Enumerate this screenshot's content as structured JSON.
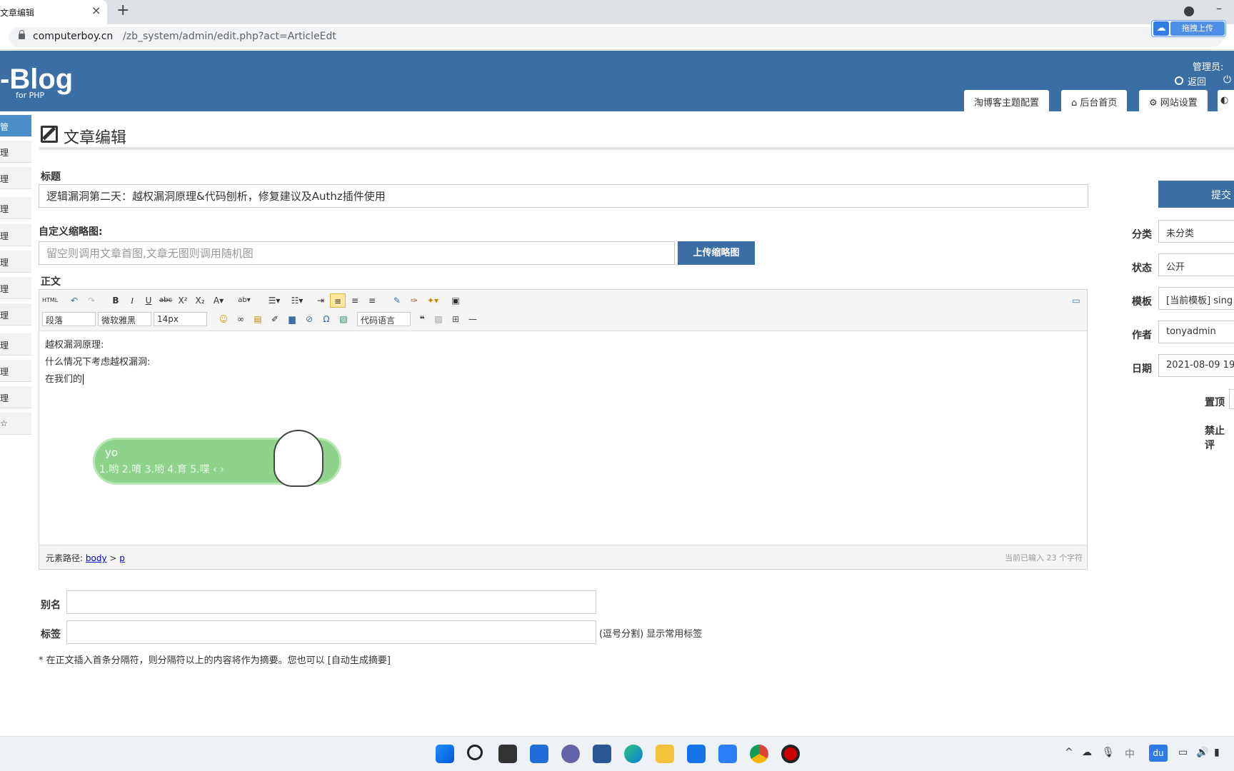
{
  "browser": {
    "tab_title": "文章编辑",
    "tab_close": "×",
    "new_tab": "+",
    "url_host": "computerboy.cn",
    "url_path": "/zb_system/admin/edit.php?act=ArticleEdt",
    "upload_extension_label": "拖拽上传",
    "minimize": "–"
  },
  "header": {
    "logo": "-Blog",
    "logo_sub": "for PHP",
    "admin_label": "管理员:",
    "back_link": "返回",
    "tabs": [
      "淘博客主题配置",
      "后台首页",
      "网站设置"
    ]
  },
  "sidebar": {
    "items": [
      "管",
      "理",
      "理",
      "理",
      "理",
      "理",
      "理",
      "理",
      "理",
      "理",
      "理",
      "☆"
    ]
  },
  "page": {
    "title": "文章编辑"
  },
  "form": {
    "title_label": "标题",
    "title_value": "逻辑漏洞第二天：越权漏洞原理&代码刨析，修复建议及Authz插件使用",
    "thumb_label": "自定义缩略图:",
    "thumb_placeholder": "留空则调用文章首图,文章无图则调用随机图",
    "upload_button": "上传缩略图",
    "body_label": "正文",
    "alias_label": "别名",
    "alias_value": "",
    "tags_label": "标签",
    "tags_value": "",
    "tags_hint": "(逗号分割) 显示常用标签",
    "summary_note": "* 在正文插入首条分隔符，则分隔符以上的内容将作为摘要。您也可以 [自动生成摘要]"
  },
  "editor": {
    "html_button": "HTML",
    "paragraph_select": "段落",
    "font_select": "微软雅黑",
    "size_select": "14px",
    "code_lang_select": "代码语言",
    "lines": [
      "越权漏洞原理:",
      "什么情况下考虑越权漏洞:",
      "在我们的"
    ],
    "path_label": "元素路径:",
    "path_body": "body",
    "path_sep": ">",
    "path_p": "p",
    "char_count": "当前已输入 23 个字符",
    "toolbar_icons": [
      "html-icon",
      "undo-icon",
      "redo-icon",
      "bold-icon",
      "italic-icon",
      "underline-icon",
      "strikethrough-icon",
      "superscript-icon",
      "subscript-icon",
      "font-color-icon",
      "highlight-icon",
      "ordered-list-icon",
      "unordered-list-icon",
      "indent-icon",
      "align-left-icon",
      "align-center-icon",
      "align-right-icon",
      "eraser-icon",
      "format-brush-icon",
      "auto-format-icon",
      "paste-icon",
      "fullscreen-icon",
      "emoji-icon",
      "link-icon",
      "image-icon",
      "scrawl-icon",
      "save-icon",
      "attachment-icon",
      "special-char-icon",
      "insert-frame-icon",
      "blockquote-icon",
      "insert-image-icon",
      "table-icon",
      "horizontal-rule-icon"
    ]
  },
  "ime": {
    "input": "yo",
    "candidates": "1.哟  2.唷  3.哟  4.育  5.喋  ‹ ›"
  },
  "right_panel": {
    "submit_button": "提交",
    "category_label": "分类",
    "category_value": "未分类",
    "status_label": "状态",
    "status_value": "公开",
    "template_label": "模板",
    "template_value": "[当前模板] sing",
    "author_label": "作者",
    "author_value": "tonyadmin",
    "date_label": "日期",
    "date_value": "2021-08-09 19:",
    "top_label": "置顶",
    "comment_label": "禁止评"
  },
  "taskbar": {
    "icons": [
      "windows-start-icon",
      "search-icon",
      "task-view-icon",
      "widgets-icon",
      "chat-icon",
      "store-icon",
      "edge-icon",
      "file-explorer-icon",
      "mail-icon",
      "feishu-icon",
      "chrome-icon",
      "record-icon"
    ],
    "tray_chevron": "^",
    "tray_ime": "中",
    "tray_du": "du"
  },
  "colors": {
    "header_blue": "#3a6ea5",
    "sidebar_active": "#4b8ec9",
    "ime_green": "#8ed28c"
  }
}
